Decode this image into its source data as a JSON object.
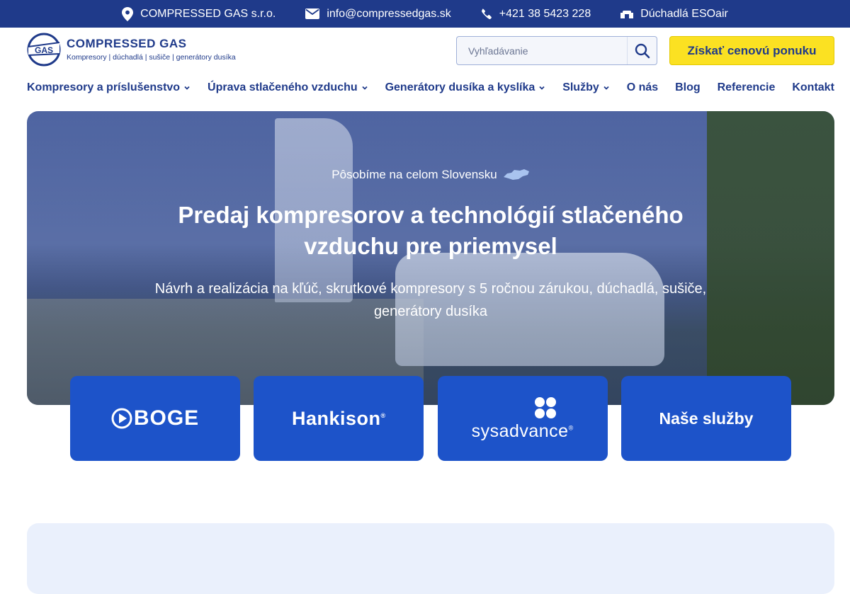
{
  "topbar": {
    "company": "COMPRESSED GAS s.r.o.",
    "email": "info@compressedgas.sk",
    "phone": "+421 38 5423 228",
    "product": "Dúchadlá ESOair"
  },
  "logo": {
    "mark": "GAS",
    "title": "COMPRESSED GAS",
    "subtitle": "Kompresory | dúchadlá | sušiče | generátory dusíka"
  },
  "search": {
    "placeholder": "Vyhľadávanie"
  },
  "cta": {
    "label": "Získať cenovú ponuku"
  },
  "nav": {
    "items": [
      {
        "label": "Kompresory a príslušenstvo"
      },
      {
        "label": "Úprava stlačeného vzduchu"
      },
      {
        "label": "Generátory dusíka a kyslíka"
      },
      {
        "label": "Služby"
      },
      {
        "label": "O nás"
      },
      {
        "label": "Blog"
      },
      {
        "label": "Referencie"
      },
      {
        "label": "Kontakt"
      }
    ]
  },
  "hero": {
    "tagline": "Pôsobíme na celom Slovensku",
    "title": "Predaj kompresorov a technológií stlačeného vzduchu pre priemysel",
    "subtitle": "Návrh a realizácia na kľúč, skrutkové kompresory s 5 ročnou zárukou, dúchadlá, sušiče, generátory dusíka"
  },
  "cards": {
    "boge": "BOGE",
    "hankison": "Hankison",
    "sysadvance": "sysadvance",
    "services": "Naše služby"
  },
  "colors": {
    "primary": "#1f3a8a",
    "card": "#1d53c9",
    "cta": "#fbe122",
    "section": "#eaf0fc"
  }
}
